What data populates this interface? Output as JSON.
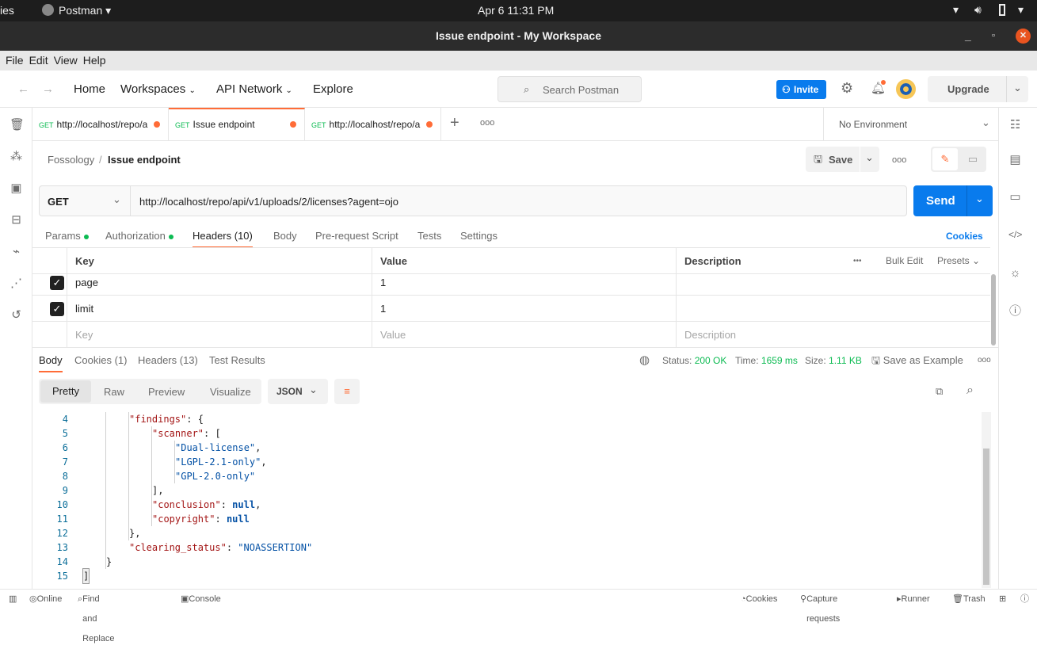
{
  "system": {
    "activities": "ies",
    "app": "Postman ▾",
    "clock": "Apr 6  11:31 PM"
  },
  "window": {
    "title": "Issue endpoint - My Workspace"
  },
  "menu": [
    "File",
    "Edit",
    "View",
    "Help"
  ],
  "header": {
    "nav": [
      "Home",
      "Workspaces",
      "API Network",
      "Explore"
    ],
    "search_placeholder": "Search Postman",
    "invite": "Invite",
    "upgrade": "Upgrade"
  },
  "tabs": [
    {
      "method": "GET",
      "label": "http://localhost/repo/a"
    },
    {
      "method": "GET",
      "label": "Issue endpoint",
      "active": true
    },
    {
      "method": "GET",
      "label": "http://localhost/repo/a"
    }
  ],
  "environment": "No Environment",
  "breadcrumb": {
    "parent": "Fossology",
    "current": "Issue endpoint"
  },
  "actions": {
    "save": "Save",
    "send": "Send"
  },
  "request": {
    "method": "GET",
    "url": "http://localhost/repo/api/v1/uploads/2/licenses?agent=ojo"
  },
  "request_tabs": [
    "Params",
    "Authorization",
    "Headers (10)",
    "Body",
    "Pre-request Script",
    "Tests",
    "Settings"
  ],
  "cookies_link": "Cookies",
  "headers_table": {
    "columns": [
      "Key",
      "Value",
      "Description"
    ],
    "bulk_edit": "Bulk Edit",
    "presets": "Presets",
    "rows": [
      {
        "key": "page",
        "value": "1",
        "checked": true
      },
      {
        "key": "limit",
        "value": "1",
        "checked": true
      }
    ],
    "placeholders": {
      "key": "Key",
      "value": "Value",
      "description": "Description"
    }
  },
  "response": {
    "tabs": [
      "Body",
      "Cookies (1)",
      "Headers (13)",
      "Test Results"
    ],
    "status_label": "Status:",
    "status": "200 OK",
    "time_label": "Time:",
    "time": "1659 ms",
    "size_label": "Size:",
    "size": "1.11 KB",
    "save_example": "Save as Example",
    "views": [
      "Pretty",
      "Raw",
      "Preview",
      "Visualize"
    ],
    "format": "JSON"
  },
  "code_lines": [
    {
      "n": "4",
      "indent": 2,
      "tokens": [
        [
          "k",
          "\"findings\""
        ],
        [
          "p",
          ": {"
        ]
      ]
    },
    {
      "n": "5",
      "indent": 3,
      "tokens": [
        [
          "k",
          "\"scanner\""
        ],
        [
          "p",
          ": ["
        ]
      ]
    },
    {
      "n": "6",
      "indent": 4,
      "tokens": [
        [
          "s",
          "\"Dual-license\""
        ],
        [
          "p",
          ","
        ]
      ]
    },
    {
      "n": "7",
      "indent": 4,
      "tokens": [
        [
          "s",
          "\"LGPL-2.1-only\""
        ],
        [
          "p",
          ","
        ]
      ]
    },
    {
      "n": "8",
      "indent": 4,
      "tokens": [
        [
          "s",
          "\"GPL-2.0-only\""
        ]
      ]
    },
    {
      "n": "9",
      "indent": 3,
      "tokens": [
        [
          "p",
          "],"
        ]
      ]
    },
    {
      "n": "10",
      "indent": 3,
      "tokens": [
        [
          "k",
          "\"conclusion\""
        ],
        [
          "p",
          ": "
        ],
        [
          "n",
          "null"
        ],
        [
          "p",
          ","
        ]
      ]
    },
    {
      "n": "11",
      "indent": 3,
      "tokens": [
        [
          "k",
          "\"copyright\""
        ],
        [
          "p",
          ": "
        ],
        [
          "n",
          "null"
        ]
      ]
    },
    {
      "n": "12",
      "indent": 2,
      "tokens": [
        [
          "p",
          "},"
        ]
      ]
    },
    {
      "n": "13",
      "indent": 2,
      "tokens": [
        [
          "k",
          "\"clearing_status\""
        ],
        [
          "p",
          ": "
        ],
        [
          "s",
          "\"NOASSERTION\""
        ]
      ]
    },
    {
      "n": "14",
      "indent": 1,
      "tokens": [
        [
          "p",
          "}"
        ]
      ]
    },
    {
      "n": "15",
      "indent": 0,
      "tokens": [
        [
          "p",
          "]"
        ]
      ]
    }
  ],
  "statusbar": {
    "online": "Online",
    "find": "Find and Replace",
    "console": "Console",
    "cookies": "Cookies",
    "capture": "Capture requests",
    "runner": "Runner",
    "trash": "Trash"
  },
  "colors": {
    "accent": "#ff6c37",
    "primary": "#097bed",
    "success": "#0cbb52"
  }
}
